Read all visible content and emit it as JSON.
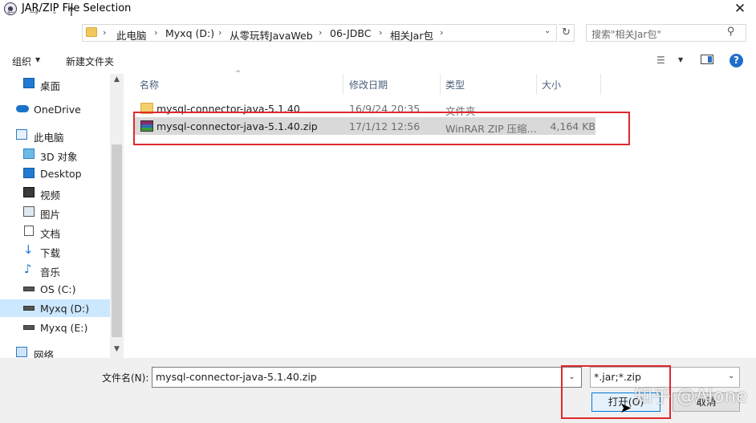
{
  "window": {
    "title": "JAR/ZIP File Selection",
    "close_glyph": "✕"
  },
  "navigation": {
    "back_glyph": "←",
    "forward_glyph": "→",
    "recent_glyph": "⌄",
    "up_glyph": "↑",
    "breadcrumbs": [
      "此电脑",
      "Myxq (D:)",
      "从零玩转JavaWeb",
      "06-JDBC",
      "相关Jar包"
    ],
    "separator": "›",
    "refresh_glyph": "↻",
    "dropdown_glyph": "⌄",
    "search_placeholder": "搜索\"相关Jar包\"",
    "search_glyph": "⚲"
  },
  "toolbar": {
    "organize": "组织",
    "caret": "▼",
    "new_folder": "新建文件夹",
    "view_glyph": "☰"
  },
  "sidebar": {
    "items": [
      {
        "label": "桌面",
        "icon": "desktop-icon"
      },
      {
        "label": "OneDrive",
        "icon": "cloud-icon"
      },
      {
        "label": "此电脑",
        "icon": "computer-icon"
      },
      {
        "label": "3D 对象",
        "icon": "cube-icon"
      },
      {
        "label": "Desktop",
        "icon": "desktop-icon"
      },
      {
        "label": "视频",
        "icon": "video-icon"
      },
      {
        "label": "图片",
        "icon": "picture-icon"
      },
      {
        "label": "文档",
        "icon": "document-icon"
      },
      {
        "label": "下载",
        "icon": "download-icon"
      },
      {
        "label": "音乐",
        "icon": "music-icon"
      },
      {
        "label": "OS (C:)",
        "icon": "drive-icon"
      },
      {
        "label": "Myxq (D:)",
        "icon": "drive-icon"
      },
      {
        "label": "Myxq (E:)",
        "icon": "drive-icon"
      },
      {
        "label": "网络",
        "icon": "network-icon"
      }
    ],
    "selected_index": 11,
    "scroll_up": "▲",
    "scroll_down": "▼"
  },
  "columns": {
    "name": "名称",
    "date": "修改日期",
    "type": "类型",
    "size": "大小",
    "sort_glyph": "^"
  },
  "files": [
    {
      "name": "mysql-connector-java-5.1.40",
      "date": "16/9/24 20:35",
      "type": "文件夹",
      "size": "",
      "icon": "folder-icon"
    },
    {
      "name": "mysql-connector-java-5.1.40.zip",
      "date": "17/1/12 12:56",
      "type": "WinRAR ZIP 压缩...",
      "size": "4,164 KB",
      "icon": "winrar-archive-icon"
    }
  ],
  "bottom": {
    "filename_label": "文件名(N):",
    "filename_value": "mysql-connector-java-5.1.40.zip",
    "filetype_value": "*.jar;*.zip",
    "open_label": "打开(O)",
    "cancel_label": "取消",
    "dropdown_glyph": "⌄",
    "cursor_glyph": "➤"
  },
  "watermark": "知乎 @Alone",
  "colors": {
    "accent": "#0078d7",
    "highlight_red": "#e0292e",
    "selected_nav": "#cce8ff",
    "selected_row": "#d9d9d9"
  }
}
